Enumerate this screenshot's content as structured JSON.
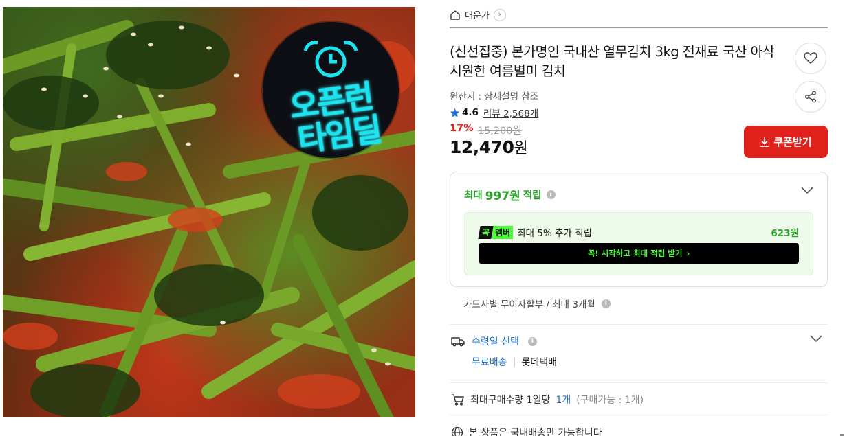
{
  "product_image": {
    "alt": "열무김치 상품 이미지",
    "badge_line1": "오픈런",
    "badge_line2": "타임딜"
  },
  "breadcrumb": {
    "home_icon": "home-icon",
    "label": "대운가"
  },
  "title": "(신선집중) 본가명인 국내산 열무김치 3kg 전재료 국산 아삭 시원한 여름별미 김치",
  "origin": "원산지 : 상세설명 참조",
  "rating": {
    "score": "4.6",
    "reviews": "리뷰 2,568개"
  },
  "price": {
    "discount": "17%",
    "original": "15,200원",
    "sale": "12,470",
    "won": "원"
  },
  "coupon_button": "쿠폰받기",
  "reward": {
    "prefix": "최대",
    "amount": "997원",
    "suffix": "적립",
    "member_tag": "꼭",
    "member_label": "멤버",
    "member_text": "최대 5% 추가 적립",
    "member_amount": "623원",
    "cta": "꼭! 시작하고 최대 적립 받기"
  },
  "installment": "카드사별 무이자할부 / 최대 3개월",
  "delivery": {
    "label": "수령일 선택",
    "free": "무료배송",
    "carrier": "롯데택배"
  },
  "max_buy": {
    "label": "최대구매수량 1일당",
    "qty": "1개",
    "avail": "(구매가능 : 1개)"
  },
  "domestic": "본 상품은 국내배송만 가능합니다",
  "colors": {
    "accent_red": "#e0201b",
    "green": "#2aa32a",
    "blue": "#1e6fd9",
    "neon": "#4cff3a"
  }
}
